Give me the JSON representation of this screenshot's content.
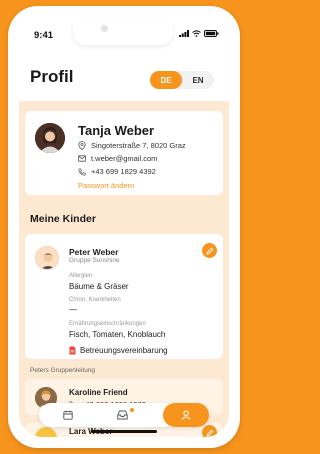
{
  "status": {
    "time": "9:41"
  },
  "header": {
    "title": "Profil",
    "languages": [
      "DE",
      "EN"
    ],
    "active_language": "DE"
  },
  "profile": {
    "name": "Tanja Weber",
    "address": "Singoterstraße 7, 8020 Graz",
    "email": "t.weber@gmail.com",
    "phone": "+43 699 1829 4392",
    "change_password": "Passwort ändern"
  },
  "children_section": {
    "title": "Meine Kinder"
  },
  "child": {
    "name": "Peter Weber",
    "group": "Gruppe Sunshine",
    "allergies_label": "Allergien",
    "allergies_value": "Bäume & Gräser",
    "chronic_label": "Chron. Krankheiten",
    "chronic_value": "—",
    "nutrition_label": "Ernährungseinschränkungen",
    "nutrition_value": "Fisch, Tomaten, Knoblauch",
    "document_label": "Betreuungsvereinbarung"
  },
  "group_leaders": {
    "label": "Peters Gruppenleitung",
    "leaders": [
      {
        "name": "Karoline Friend",
        "phone": "+43 699 1263 1582"
      },
      {
        "name": "Lara Weber"
      }
    ]
  },
  "tabbar": {
    "tabs": [
      "calendar-icon",
      "inbox-icon",
      "profile-icon"
    ],
    "active": "profile-icon"
  },
  "colors": {
    "accent": "#f7941d",
    "background": "#fde9d2"
  }
}
